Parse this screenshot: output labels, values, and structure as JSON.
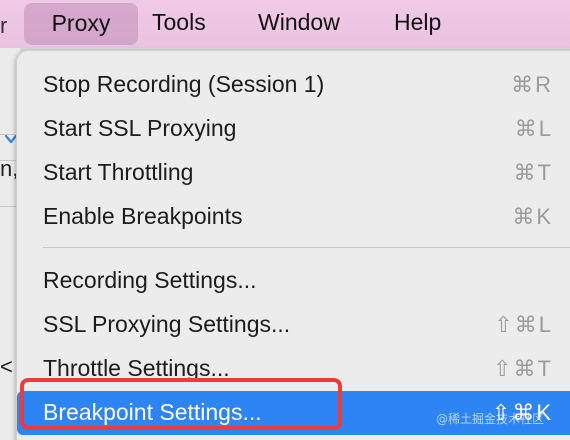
{
  "menubar": {
    "left_fragment": "r",
    "items": [
      {
        "label": "Proxy"
      },
      {
        "label": "Tools"
      },
      {
        "label": "Window"
      },
      {
        "label": "Help"
      }
    ]
  },
  "background": {
    "fragment_text": "n,",
    "back_glyph": "<"
  },
  "proxy_menu": {
    "items": [
      {
        "label": "Stop Recording (Session 1)",
        "shortcut": "⌘R"
      },
      {
        "label": "Start SSL Proxying",
        "shortcut": "⌘L"
      },
      {
        "label": "Start Throttling",
        "shortcut": "⌘T"
      },
      {
        "label": "Enable Breakpoints",
        "shortcut": "⌘K"
      },
      {
        "label": "Recording Settings...",
        "shortcut": ""
      },
      {
        "label": "SSL Proxying Settings...",
        "shortcut": "⇧⌘L"
      },
      {
        "label": "Throttle Settings...",
        "shortcut": "⇧⌘T"
      },
      {
        "label": "Breakpoint Settings...",
        "shortcut": "⇧⌘K"
      }
    ],
    "highlighted_index": 7
  },
  "watermark": "@稀土掘金技术社区",
  "colors": {
    "menubar_bg": "#ecc6e3",
    "highlight": "#2d84f4",
    "annotation": "#ec3b3b"
  }
}
